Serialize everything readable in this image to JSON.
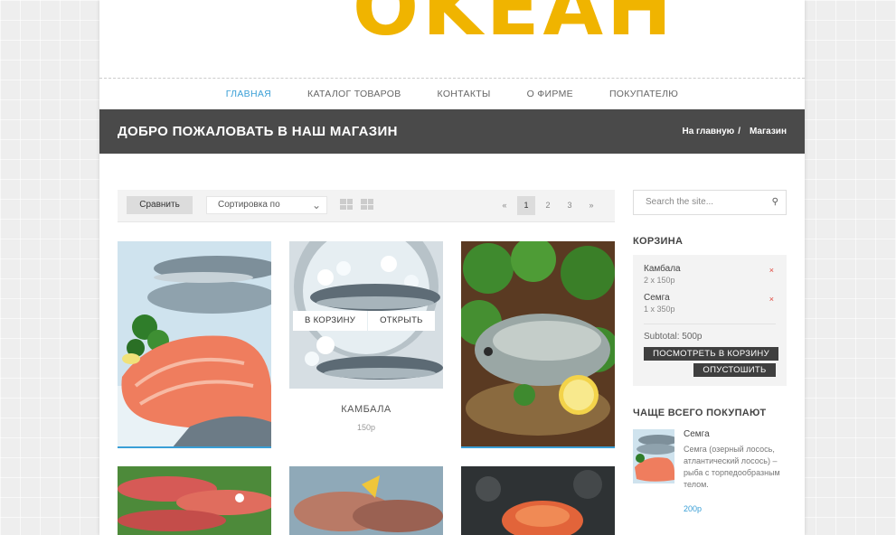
{
  "logo": "OKEAH",
  "nav": [
    "ГЛАВНАЯ",
    "КАТАЛОГ ТОВАРОВ",
    "КОНТАКТЫ",
    "О ФИРМЕ",
    "ПОКУПАТЕЛЮ"
  ],
  "banner": {
    "title": "ДОБРО ПОЖАЛОВАТЬ В НАШ МАГАЗИН",
    "crumb_home": "На главную",
    "crumb_sep": "/",
    "crumb_current": "Магазин"
  },
  "toolbar": {
    "compare": "Сравнить",
    "sort_label": "Сортировка по",
    "pages": [
      "«",
      "1",
      "2",
      "3",
      "»"
    ],
    "current_page": "1"
  },
  "products": [
    {
      "name": "",
      "price": ""
    },
    {
      "name": "КАМБАЛА",
      "price": "150р",
      "add_to_cart": "В КОРЗИНУ",
      "open": "ОТКРЫТЬ"
    },
    {
      "name": "",
      "price": ""
    }
  ],
  "sidebar": {
    "search_placeholder": "Search the site...",
    "cart_heading": "КОРЗИНА",
    "cart_items": [
      {
        "name": "Камбала",
        "qty": "2 x 150р"
      },
      {
        "name": "Семга",
        "qty": "1 x 350р"
      }
    ],
    "subtotal": "Subtotal: 500р",
    "view_cart": "ПОСМОТРЕТЬ В КОРЗИНУ",
    "empty_cart": "ОПУСТОШИТЬ",
    "popular_heading": "ЧАЩЕ ВСЕГО ПОКУПАЮТ",
    "popular": {
      "title": "Семга",
      "desc": "Семга (озерный лосось, атлантический лосось) – рыба с торпедообразным телом.",
      "price": "200р"
    }
  },
  "colors": {
    "accent": "#3a9fd6",
    "logo": "#f0b400",
    "banner": "#4a4a4a",
    "remove": "#e0443a"
  }
}
